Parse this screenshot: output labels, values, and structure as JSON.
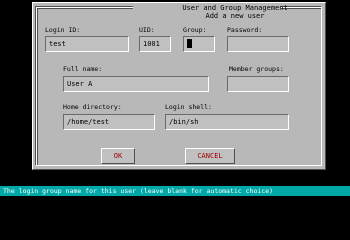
{
  "dialog": {
    "title": "User and Group Management",
    "subtitle": "Add a new user"
  },
  "fields": {
    "login_id": {
      "label": "Login ID:",
      "value": "test"
    },
    "uid": {
      "label": "UID:",
      "value": "1001"
    },
    "group": {
      "label": "Group:",
      "value": ""
    },
    "password": {
      "label": "Password:",
      "value": ""
    },
    "full_name": {
      "label": "Full name:",
      "value": "User A"
    },
    "member_groups": {
      "label": "Member groups:",
      "value": ""
    },
    "home_directory": {
      "label": "Home directory:",
      "value": "/home/test"
    },
    "login_shell": {
      "label": "Login shell:",
      "value": "/bin/sh"
    }
  },
  "buttons": {
    "ok_label": "OK",
    "cancel_label": "CANCEL"
  },
  "status": {
    "text": "The login group name for this user (leave blank for automatic choice)"
  },
  "colors": {
    "dialog_bg": "#b8b8b8",
    "status_bg": "#00a8a8",
    "button_text": "#a00000"
  }
}
